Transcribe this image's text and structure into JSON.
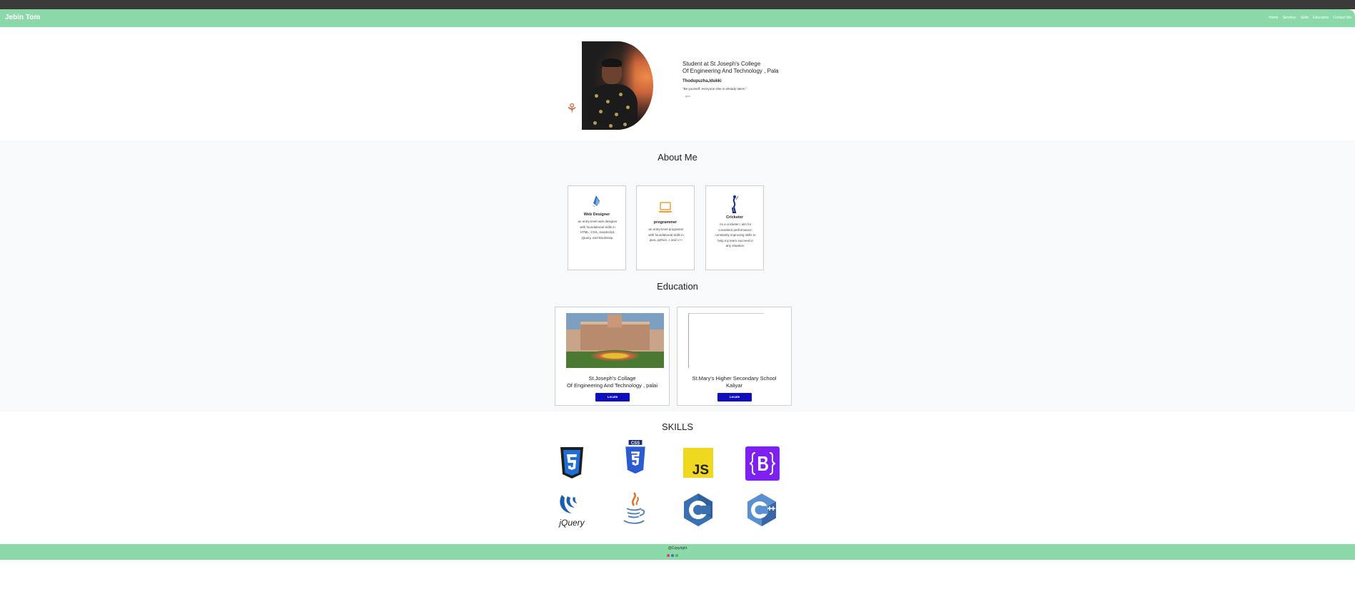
{
  "navbar": {
    "brand": "Jebin Tom",
    "links": [
      "Home",
      "Services",
      "Skills",
      "Education",
      "Contact Me"
    ]
  },
  "hero": {
    "title_line1": "Student at St Joseph's College",
    "title_line2": "Of Engineering And Technology , Pala",
    "location": "Thodupuzha,Idukki",
    "quote": "\"Be yourself; everyone else is already taken.\"",
    "author": "- gmu"
  },
  "about": {
    "title": "About Me",
    "cards": [
      {
        "icon": "web-design-icon",
        "title": "Web Designer",
        "text": "an entry-level web designer with foundational skills in HTML, CSS, JavaScript, jQuery, and Bootstrap."
      },
      {
        "icon": "laptop-icon",
        "title": "programmer",
        "text": "an entry-level programer with foundational skills in java, python, c and c++"
      },
      {
        "icon": "cricket-icon",
        "title": "Cricketer",
        "text": "As a cricketer I aim for consistent performance, constantly improving skills to help my team succeed in any situation."
      }
    ]
  },
  "education": {
    "title": "Education",
    "items": [
      {
        "name_line1": "St.Joseph's Collage",
        "name_line2": "Of Engineering And Technology , palai",
        "button": "Locate"
      },
      {
        "name_line1": "St.Mary's Higher Secondary School",
        "name_line2": "Kaliyar",
        "button": "Locate"
      }
    ]
  },
  "skills": {
    "title": "SKILLS",
    "icons": [
      "html5-icon",
      "css3-icon",
      "javascript-icon",
      "bootstrap-icon",
      "jquery-icon",
      "java-icon",
      "c-icon",
      "cpp-icon"
    ],
    "labels": {
      "css": "CSS",
      "js": "JS",
      "jquery": "jQuery"
    }
  },
  "footer": {
    "copyright": "@Copyright",
    "social_colors": [
      "#e04060",
      "#3a6fd8",
      "#50b060"
    ]
  }
}
